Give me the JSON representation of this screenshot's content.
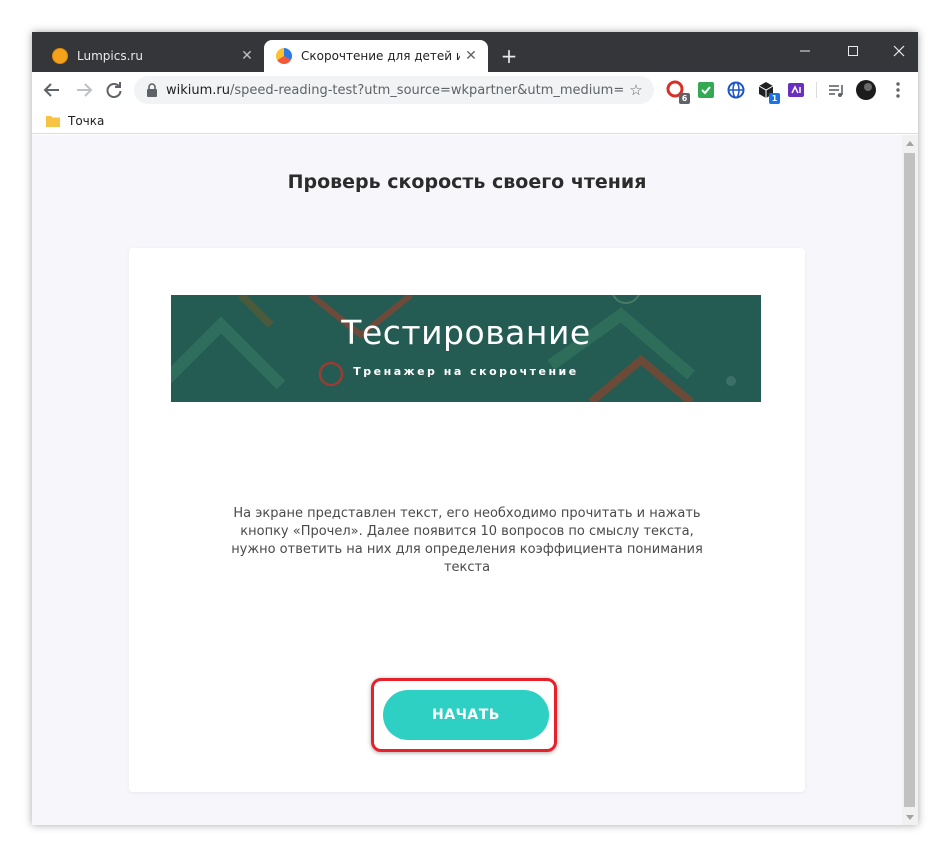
{
  "browser": {
    "tabs": [
      {
        "title": "Lumpics.ru",
        "favicon": "orange-circle-icon",
        "active": false,
        "close": "✕"
      },
      {
        "title": "Скорочтение для детей и взрос",
        "favicon": "wikium-icon",
        "active": true,
        "close": "✕"
      }
    ],
    "new_tab": "+",
    "window_controls": {
      "minimize": "–",
      "maximize": "☐",
      "close": "✕"
    },
    "url": {
      "host": "wikium.ru",
      "path": "/speed-reading-test?utm_source=wkpartner&utm_medium=cpa&..."
    },
    "star": "☆",
    "extensions": [
      {
        "name": "extension-red-icon",
        "badge": "6",
        "color": "#d93025"
      },
      {
        "name": "extension-check-icon",
        "badge": "",
        "color": "#34a853"
      },
      {
        "name": "extension-globe-icon",
        "badge": "",
        "color": "#1a56c7"
      },
      {
        "name": "extension-box-icon",
        "badge": "1",
        "color": "#202124"
      },
      {
        "name": "extension-purple-icon",
        "badge": "",
        "color": "#6b2fbf"
      }
    ],
    "bookmarks": [
      {
        "label": "Точка"
      }
    ]
  },
  "page": {
    "heading": "Проверь скорость своего чтения",
    "banner": {
      "title": "Тестирование",
      "subtitle": "Тренажер на скорочтение",
      "color": "#245c53"
    },
    "description": "На экране представлен текст, его необходимо прочитать и нажать кнопку «Прочел». Далее появится 10 вопросов по смыслу текста, нужно ответить на них для определения коэффициента понимания текста",
    "start_button": {
      "label": "НАЧАТЬ",
      "color": "#2fd0c4"
    },
    "highlight_color": "#e8202a"
  }
}
